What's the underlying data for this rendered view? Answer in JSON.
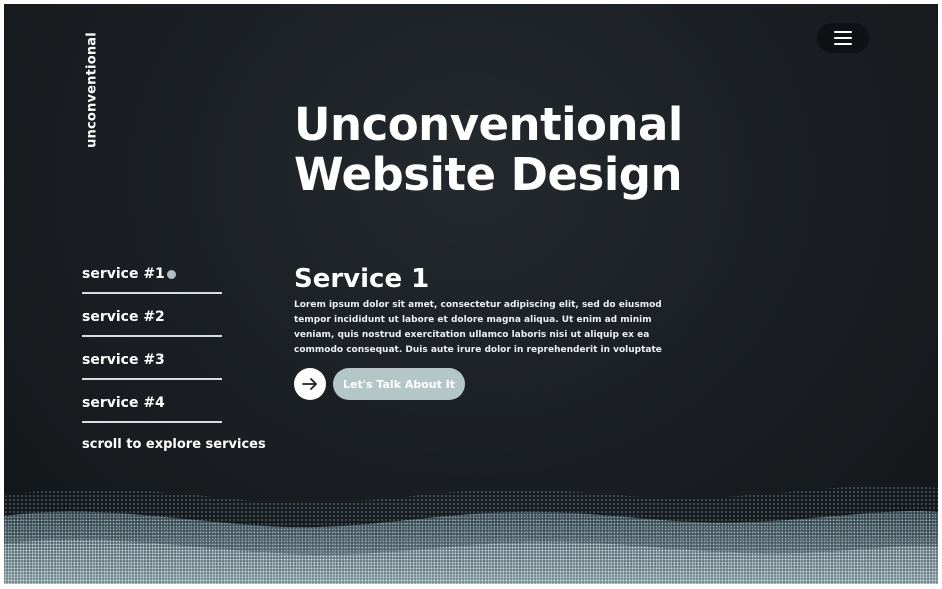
{
  "brand": {
    "name": "unconventional"
  },
  "header": {
    "menu_icon": "hamburger-menu-icon"
  },
  "hero": {
    "title_line1": "Unconventional",
    "title_line2": "Website Design"
  },
  "services_nav": {
    "items": [
      {
        "label": "service #1",
        "active": true
      },
      {
        "label": "service #2",
        "active": false
      },
      {
        "label": "service #3",
        "active": false
      },
      {
        "label": "service #4",
        "active": false
      }
    ],
    "scroll_hint": "scroll to explore services"
  },
  "service": {
    "title": "Service 1",
    "description": "Lorem ipsum dolor sit amet, consectetur adipiscing elit, sed do eiusmod tempor incididunt ut labore et dolore magna aliqua. Ut enim ad minim veniam, quis nostrud exercitation ullamco laboris nisi ut aliquip ex ea commodo consequat. Duis aute irure dolor in reprehenderit in voluptate",
    "arrow_icon": "arrow-right-icon",
    "cta_label": "Let's Talk About It"
  },
  "colors": {
    "background": "#1a1e22",
    "accent": "#b5c6c8",
    "wave": "#8fb6c2",
    "active_dot": "#b3bcc2"
  }
}
